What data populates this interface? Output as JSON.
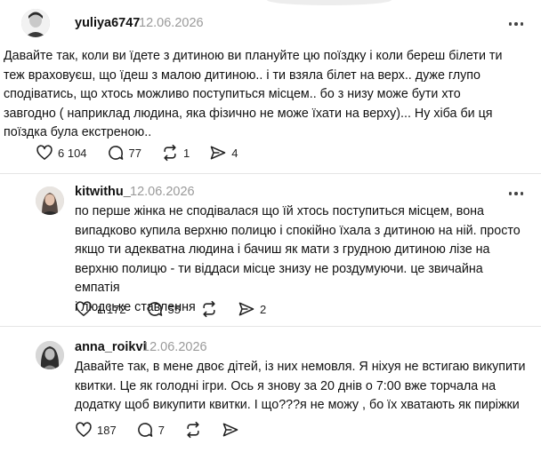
{
  "comments": [
    {
      "username": "yuliya6747",
      "date": "12.06.2026",
      "text": "Давайте так, коли ви їдете з дитиною ви плануйте цю поїздку і коли береш білети ти\nтеж враховуєш, що їдеш з малою дитиною.. і ти взяла білет на верх.. дуже глупо\nсподіватись, що хтось можливо поступиться місцем.. бо з низу може бути хто\nзавгодно ( наприклад людина, яка фізично не може їхати на верху)... Ну хіба би ця\nпоїздка була екстреною..",
      "likes": "6 104",
      "replies": "77",
      "reposts": "1",
      "shares": "4"
    },
    {
      "username": "kitwithu_",
      "date": "12.06.2026",
      "text": "по перше жінка не сподівалася що їй хтось поступиться місцем, вона\nвипадково купила верхню полицю і спокійно їхала з дитиною на ній. просто\nякщо ти адекватна людина і бачиш як мати з грудною дитиною лізе на\nверхню полицю - ти віддаси місце знизу не роздумуючи. це звичайна емпатія\nі людське ставлення",
      "likes": "1 172",
      "replies": "55",
      "reposts": "",
      "shares": "2"
    },
    {
      "username": "anna_roikvl",
      "date": "12.06.2026",
      "text": "Давайте так, в мене двоє дітей, із них немовля. Я ніхуя не встигаю викупити\nквитки. Це як голодні ігри. Ось я знову за 20 днів о 7:00 вже торчала на\nдодатку щоб викупити квитки. І що???я не можу , бо їх хватають як пиріжки",
      "likes": "187",
      "replies": "7",
      "reposts": "",
      "shares": ""
    }
  ],
  "icons": {
    "like": "heart-icon",
    "reply": "speech-bubble-icon",
    "repost": "repost-arrows-icon",
    "share": "paper-plane-icon",
    "more": "more-dots-icon"
  },
  "colors": {
    "text": "#111111",
    "muted": "#9a9a9a",
    "divider": "#e5e5e5",
    "background": "#ffffff"
  }
}
